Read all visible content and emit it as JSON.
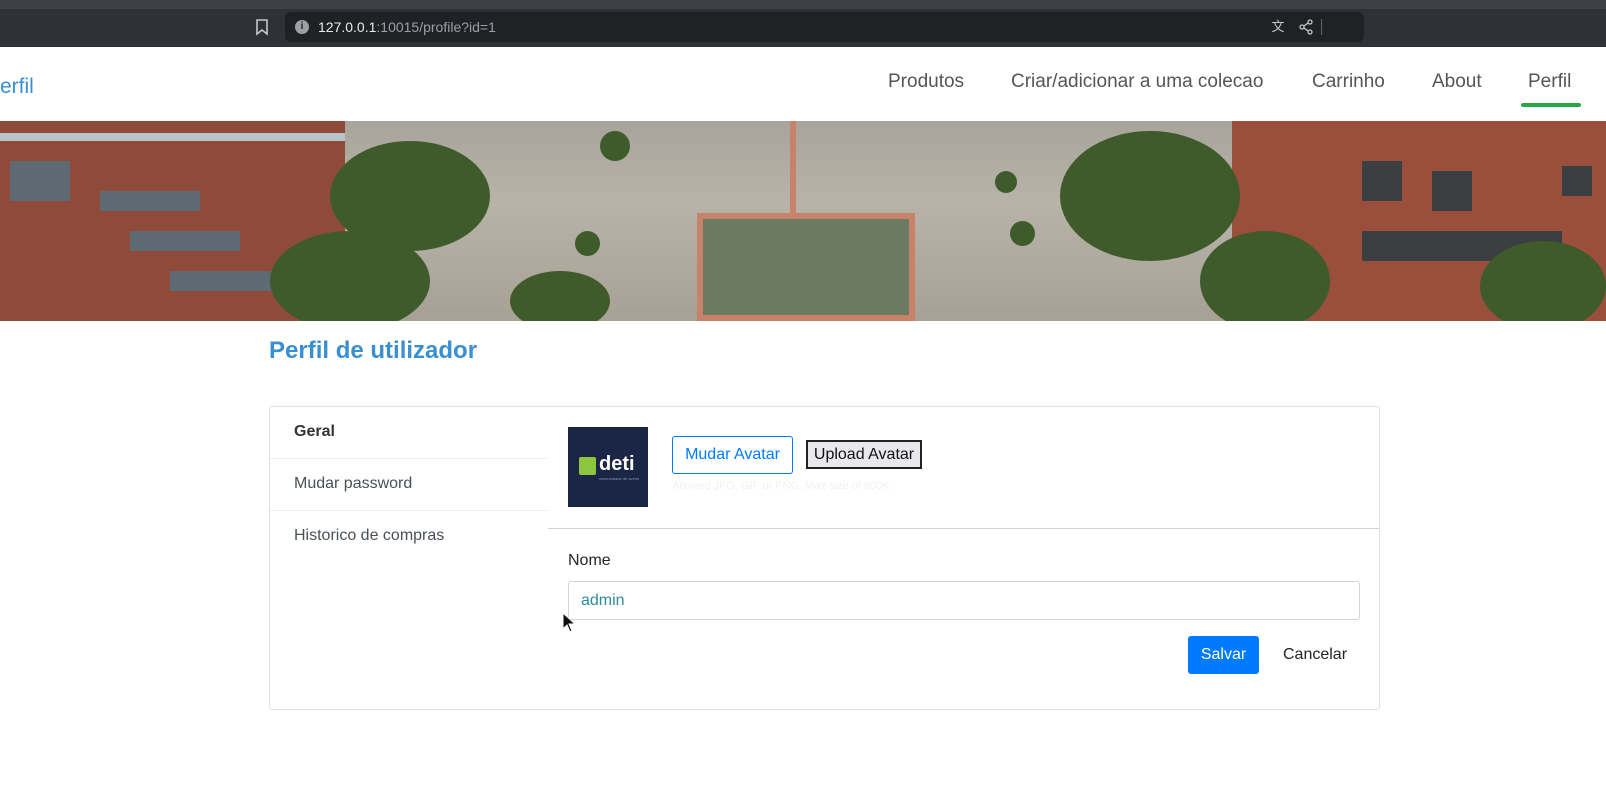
{
  "browser": {
    "url_host": "127.0.0.1",
    "url_rest": ":10015/profile?id=1",
    "icons": [
      "bookmark-icon",
      "site-info-icon",
      "translate-icon",
      "share-icon",
      "brave-shield-icon"
    ]
  },
  "navbar": {
    "brand": "erfil",
    "items": [
      {
        "label": "Produtos"
      },
      {
        "label": "Criar/adicionar a uma colecao"
      },
      {
        "label": "Carrinho"
      },
      {
        "label": "About"
      },
      {
        "label": "Perfil",
        "active": true
      }
    ],
    "active_color": "#28a745"
  },
  "page": {
    "title": "Perfil de utilizador"
  },
  "sidebar": {
    "items": [
      {
        "label": "Geral",
        "active": true
      },
      {
        "label": "Mudar password"
      },
      {
        "label": "Historico de compras"
      }
    ]
  },
  "profile": {
    "avatar_logo_text": "deti",
    "avatar_logo_sub": "universidade de aveiro",
    "change_avatar_label": "Mudar Avatar",
    "upload_avatar_label": "Upload Avatar",
    "avatar_hint": "Allowed JPG, GIF or PNG. Max size of 800K",
    "name_label": "Nome",
    "name_value": "admin",
    "save_label": "Salvar",
    "cancel_label": "Cancelar"
  },
  "colors": {
    "accent": "#3a8fd0",
    "primary": "#007bff"
  }
}
